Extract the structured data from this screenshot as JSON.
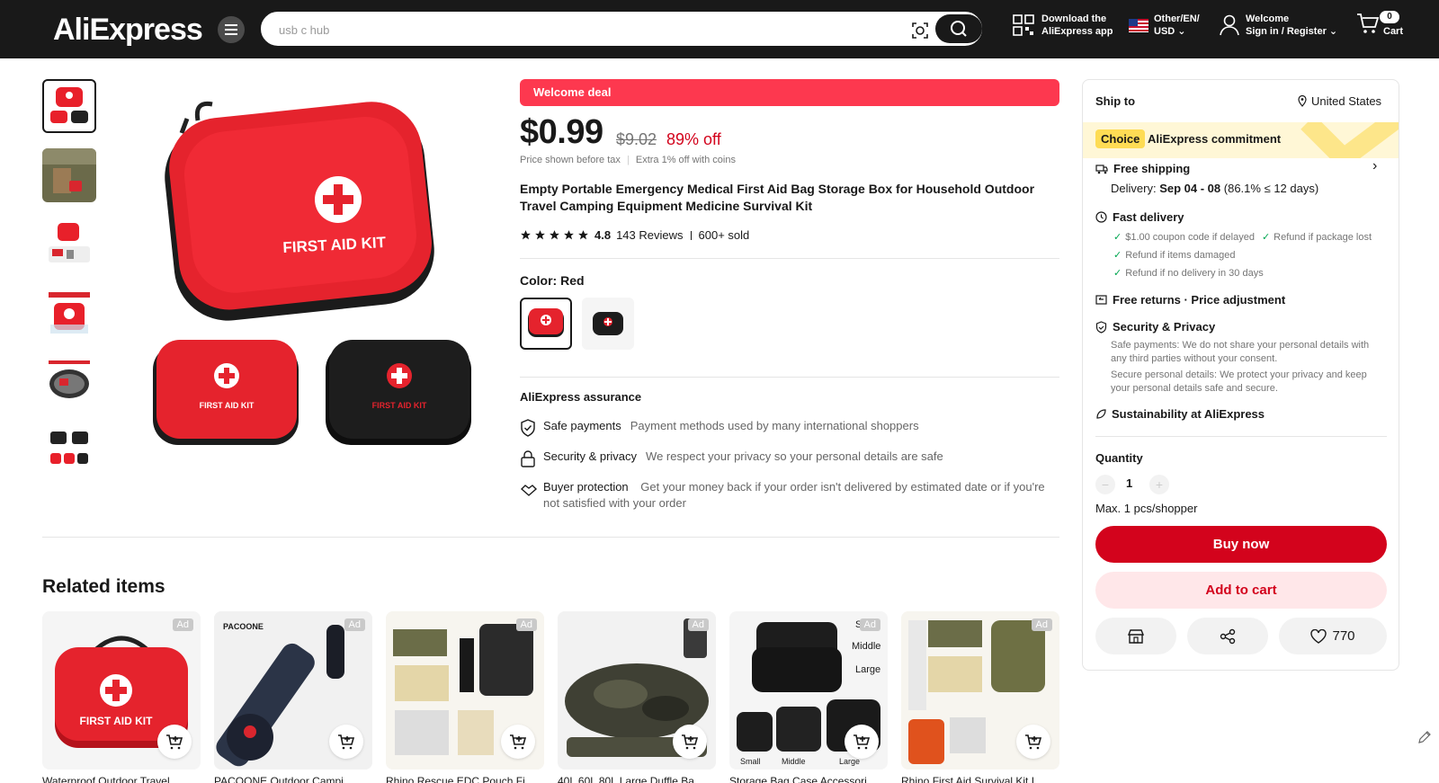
{
  "header": {
    "logo": "AliExpress",
    "search_placeholder": "usb c hub",
    "app_line1": "Download the",
    "app_line2": "AliExpress app",
    "lang_line1": "Other/EN/",
    "lang_line2": "USD",
    "user_line1": "Welcome",
    "user_line2": "Sign in / Register",
    "cart_count": "0",
    "cart_label": "Cart"
  },
  "product": {
    "welcome_deal": "Welcome deal",
    "price": "$0.99",
    "old_price": "$9.02",
    "discount": "89% off",
    "tax_note": "Price shown before tax",
    "coins_note": "Extra 1% off with coins",
    "title": "Empty Portable Emergency Medical First Aid Bag Storage Box for Household Outdoor Travel Camping Equipment Medicine Survival Kit",
    "rating": "4.8",
    "reviews": "143 Reviews",
    "sold": "600+ sold",
    "color_label": "Color: Red",
    "kit_label": "FIRST AID KIT"
  },
  "assurance": {
    "title": "AliExpress assurance",
    "items": [
      {
        "name": "Safe payments",
        "desc": "Payment methods used by many international shoppers"
      },
      {
        "name": "Security & privacy",
        "desc": "We respect your privacy so your personal details are safe"
      },
      {
        "name": "Buyer protection",
        "desc": "Get your money back if your order isn't delivered by estimated date or if you're not satisfied with your order"
      }
    ]
  },
  "related": {
    "title": "Related items",
    "ad_label": "Ad",
    "items": [
      {
        "title": "Waterproof Outdoor Travel..."
      },
      {
        "title": "PACOONE Outdoor Campi..."
      },
      {
        "title": "Rhino Rescue EDC Pouch Fi..."
      },
      {
        "title": "40L 60L 80L Large Duffle Ba..."
      },
      {
        "title": "Storage Bag Case Accessori..."
      },
      {
        "title": "Rhino First Aid Survival Kit I..."
      }
    ]
  },
  "panel": {
    "ship_to": "Ship to",
    "country": "United States",
    "choice_badge": "Choice",
    "choice_text": "AliExpress commitment",
    "free_shipping": "Free shipping",
    "delivery_prefix": "Delivery:",
    "delivery_dates": "Sep 04 - 08",
    "delivery_note": "(86.1% ≤ 12 days)",
    "fast_delivery": "Fast delivery",
    "fd_items": [
      "$1.00 coupon code if delayed",
      "Refund if package lost",
      "Refund if items damaged",
      "Refund if no delivery in 30 days"
    ],
    "free_returns": "Free returns · Price adjustment",
    "security": "Security & Privacy",
    "security_text1": "Safe payments: We do not share your personal details with any third parties without your consent.",
    "security_text2": "Secure personal details: We protect your privacy and keep your personal details safe and secure.",
    "sustainability": "Sustainability at AliExpress",
    "quantity_label": "Quantity",
    "quantity": "1",
    "max_note": "Max. 1 pcs/shopper",
    "buy_now": "Buy now",
    "add_to_cart": "Add to cart",
    "wishlist_count": "770"
  },
  "colors": {
    "accent_red": "#d3031c",
    "welcome_red": "#fd384f",
    "choice_yellow": "#fedc54",
    "header_bg": "#191919"
  }
}
